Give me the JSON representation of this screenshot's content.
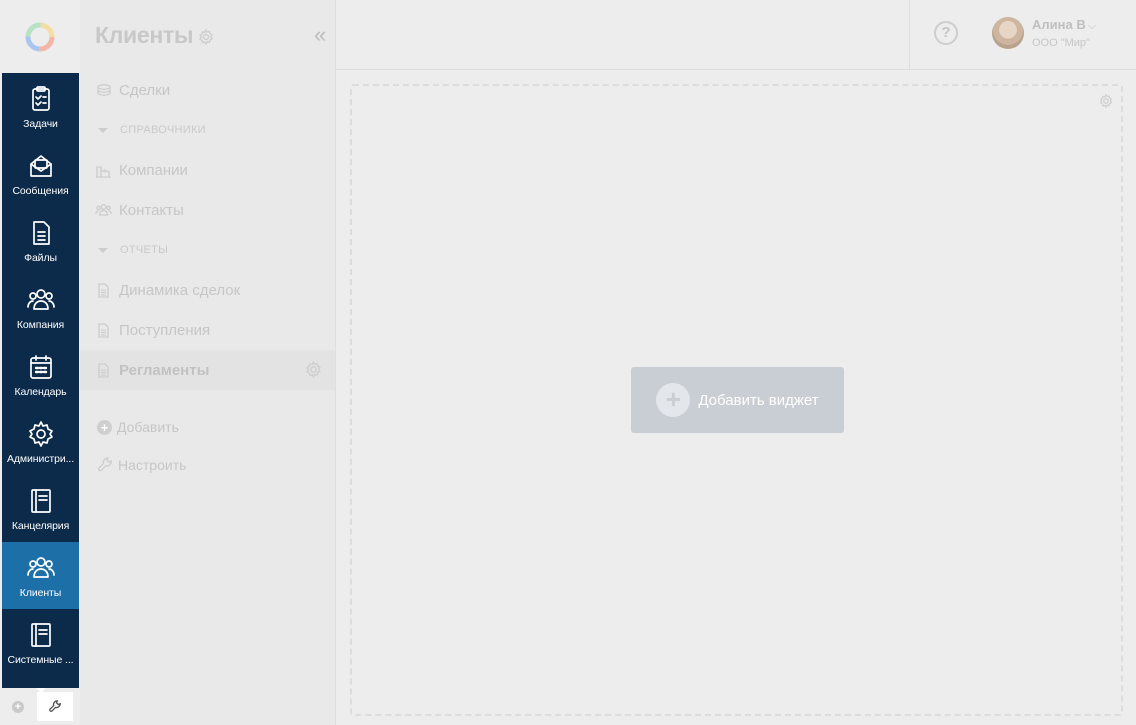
{
  "rail": {
    "items": [
      {
        "label": "Задачи",
        "icon": "tasks-icon"
      },
      {
        "label": "Сообщения",
        "icon": "messages-icon"
      },
      {
        "label": "Файлы",
        "icon": "files-icon"
      },
      {
        "label": "Компания",
        "icon": "company-icon"
      },
      {
        "label": "Календарь",
        "icon": "calendar-icon"
      },
      {
        "label": "Администри...",
        "icon": "admin-gear-icon"
      },
      {
        "label": "Канцелярия",
        "icon": "office-book-icon"
      },
      {
        "label": "Клиенты",
        "icon": "clients-icon"
      },
      {
        "label": "Системные ...",
        "icon": "system-book-icon"
      }
    ],
    "active": "Клиенты"
  },
  "sidebar": {
    "title": "Клиенты",
    "collapse_glyph": "«",
    "items": [
      {
        "label": "Сделки"
      },
      {
        "group": "СПРАВОЧНИКИ"
      },
      {
        "label": "Компании"
      },
      {
        "label": "Контакты"
      },
      {
        "group": "ОТЧЕТЫ"
      },
      {
        "label": "Динамика сделок"
      },
      {
        "label": "Поступления"
      },
      {
        "label": "Регламенты"
      }
    ],
    "add_label": "Добавить",
    "configure_label": "Настроить"
  },
  "header": {
    "help_glyph": "?",
    "user_name": "Алина В",
    "user_chevron": "⌵",
    "user_org": "ООО \"Мир\""
  },
  "main": {
    "add_widget_label": "Добавить виджет",
    "add_widget_glyph": "+"
  },
  "colors": {
    "rail_bg": "#0c2a4a",
    "rail_active": "#1d6fa8",
    "page_bg": "#ededed",
    "add_widget_bg": "#c9ced4"
  }
}
